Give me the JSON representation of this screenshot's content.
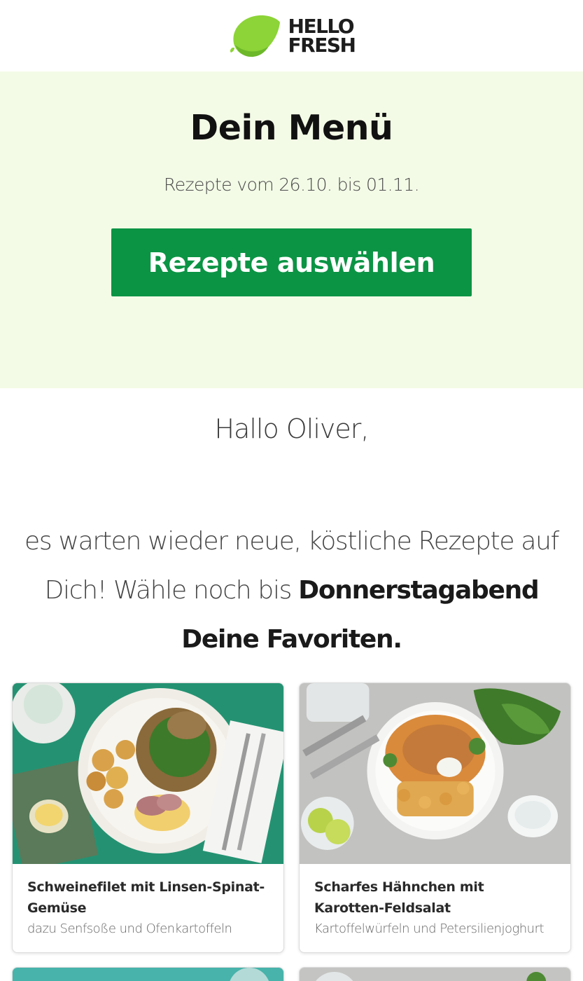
{
  "header": {
    "logo_line1": "HELLO",
    "logo_line2": "FRESH",
    "lime_color": "#8cd437"
  },
  "hero": {
    "title": "Dein Menü",
    "subtitle": "Rezepte vom 26.10. bis 01.11.",
    "cta_label": "Rezepte auswählen",
    "background": "#f3fbe6",
    "cta_color": "#0b9444"
  },
  "greeting": "Hallo Oliver,",
  "intro": {
    "text_before": "es warten wieder neue, köstliche Rezepte auf Dich! Wähle noch bis ",
    "bold": "Donnerstagabend Deine Favoriten."
  },
  "recipes": [
    {
      "title": "Schweinefilet mit Linsen-Spinat-Gemüse",
      "subtitle": "dazu Senfsoße und Ofenkartoffeln",
      "image": "pork-lentil-spinach-dish"
    },
    {
      "title": "Scharfes Hähnchen mit Karotten-Feldsalat",
      "subtitle": "Kartoffelwürfeln und Petersilienjoghurt",
      "image": "spicy-chicken-carrot-salad-dish"
    }
  ]
}
